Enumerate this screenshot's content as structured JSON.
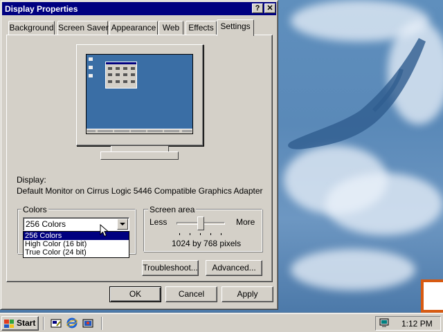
{
  "window": {
    "title": "Display Properties",
    "help_btn": "?",
    "close_btn": "✕"
  },
  "tabs": [
    {
      "label": "Background",
      "active": false
    },
    {
      "label": "Screen Saver",
      "active": false
    },
    {
      "label": "Appearance",
      "active": false
    },
    {
      "label": "Web",
      "active": false
    },
    {
      "label": "Effects",
      "active": false
    },
    {
      "label": "Settings",
      "active": true
    }
  ],
  "display": {
    "heading": "Display:",
    "device": "Default Monitor on Cirrus Logic 5446 Compatible Graphics Adapter"
  },
  "colors": {
    "group_title": "Colors",
    "selected": "256 Colors",
    "options": [
      "256 Colors",
      "High Color (16 bit)",
      "True Color (24 bit)"
    ],
    "highlighted_option": "256 Colors"
  },
  "screen_area": {
    "group_title": "Screen area",
    "less_label": "Less",
    "more_label": "More",
    "resolution": "1024 by 768 pixels",
    "slider_position": 0.5
  },
  "buttons": {
    "troubleshoot": "Troubleshoot...",
    "advanced": "Advanced...",
    "ok": "OK",
    "cancel": "Cancel",
    "apply": "Apply"
  },
  "taskbar": {
    "start_label": "Start",
    "clock": "1:12 PM",
    "quick_launch": [
      "show-desktop-icon",
      "internet-explorer-icon",
      "channels-icon"
    ],
    "tray_icon": "monitor-icon"
  },
  "colors_theme": {
    "titlebar": "#000080",
    "face": "#d4d0c8",
    "desktop": "#3a6ea5",
    "selection": "#000080"
  }
}
